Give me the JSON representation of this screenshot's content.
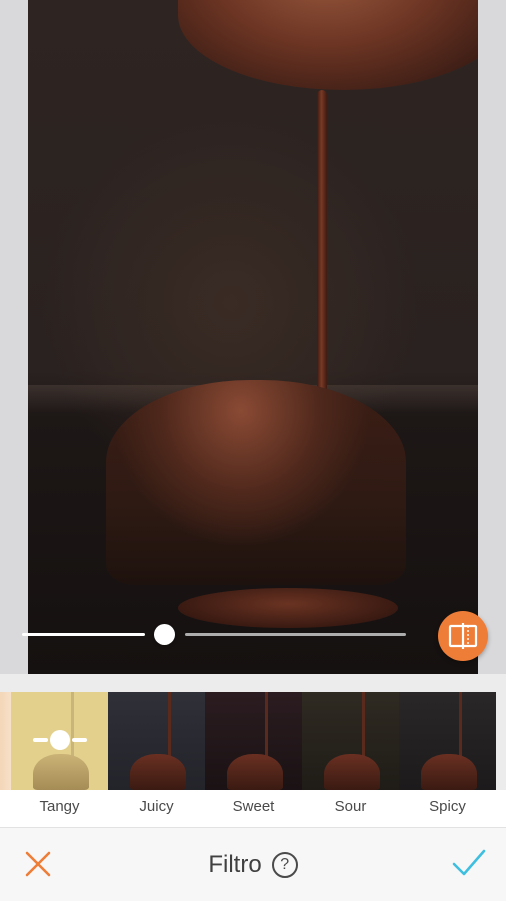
{
  "editor": {
    "slider": {
      "value": 0.42
    }
  },
  "filters": [
    {
      "label": "Tangy",
      "selected": true
    },
    {
      "label": "Juicy",
      "selected": false
    },
    {
      "label": "Sweet",
      "selected": false
    },
    {
      "label": "Sour",
      "selected": false
    },
    {
      "label": "Spicy",
      "selected": false
    }
  ],
  "toolbar": {
    "title": "Filtro",
    "help_glyph": "?"
  },
  "icons": {
    "cancel": "close-icon",
    "confirm": "checkmark-icon",
    "compare": "compare-icon",
    "help": "help-icon",
    "intensity": "intensity-slider-icon"
  },
  "colors": {
    "accent_orange": "#ee7d38",
    "confirm_cyan": "#3fbfe0"
  }
}
